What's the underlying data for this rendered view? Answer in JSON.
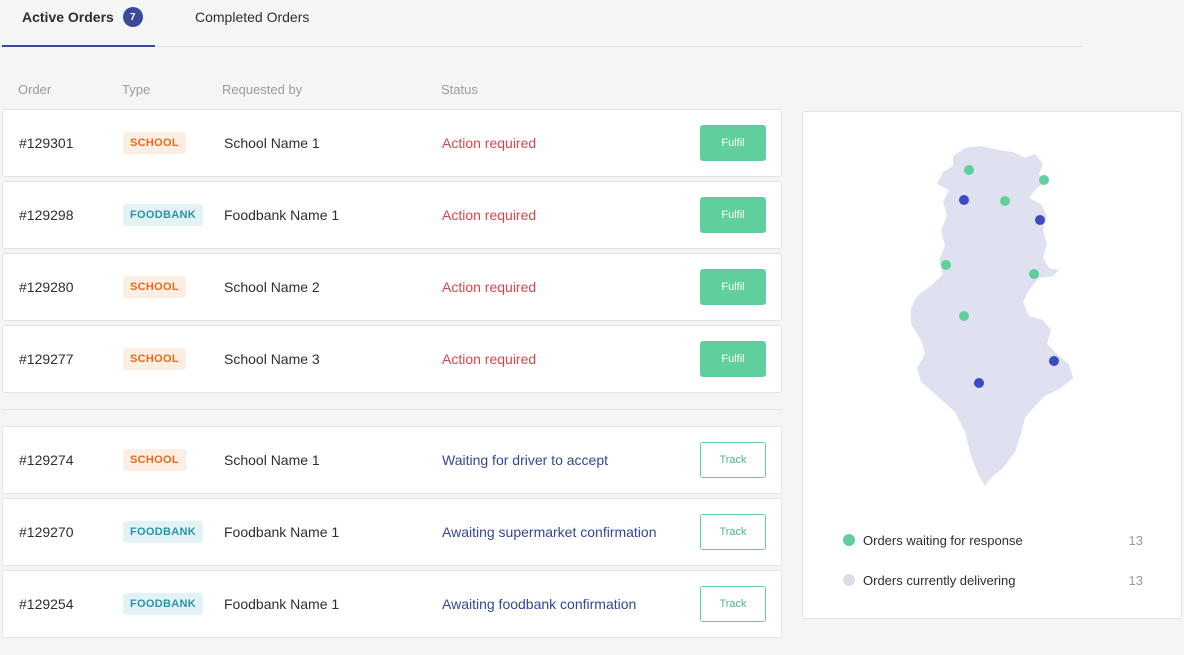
{
  "tabs": [
    {
      "label": "Active Orders",
      "badge": "7"
    },
    {
      "label": "Completed Orders"
    }
  ],
  "columns": {
    "order": "Order",
    "type": "Type",
    "requested_by": "Requested by",
    "status": "Status"
  },
  "orders": [
    {
      "id": "#129301",
      "type": "SCHOOL",
      "requested_by": "School Name 1",
      "status": "Action required",
      "action": "Fulfil"
    },
    {
      "id": "#129298",
      "type": "FOODBANK",
      "requested_by": "Foodbank Name 1",
      "status": "Action required",
      "action": "Fulfil"
    },
    {
      "id": "#129280",
      "type": "SCHOOL",
      "requested_by": "School Name 2",
      "status": "Action required",
      "action": "Fulfil"
    },
    {
      "id": "#129277",
      "type": "SCHOOL",
      "requested_by": "School Name 3",
      "status": "Action required",
      "action": "Fulfil"
    },
    {
      "id": "#129274",
      "type": "SCHOOL",
      "requested_by": "School Name 1",
      "status": "Waiting for driver to accept",
      "action": "Track"
    },
    {
      "id": "#129270",
      "type": "FOODBANK",
      "requested_by": "Foodbank Name 1",
      "status": "Awaiting supermarket confirmation",
      "action": "Track"
    },
    {
      "id": "#129254",
      "type": "FOODBANK",
      "requested_by": "Foodbank Name 1",
      "status": "Awaiting foodbank confirmation",
      "action": "Track"
    }
  ],
  "map": {
    "legend": [
      {
        "label": "Orders waiting for response",
        "count": "13",
        "color": "#5fcf9b"
      },
      {
        "label": "Orders currently delivering",
        "count": "13",
        "color": "#dcdde8"
      }
    ],
    "colors": {
      "waiting": "#5fcf9b",
      "delivering": "#3c4ac4",
      "land": "#dfe1f1"
    }
  }
}
